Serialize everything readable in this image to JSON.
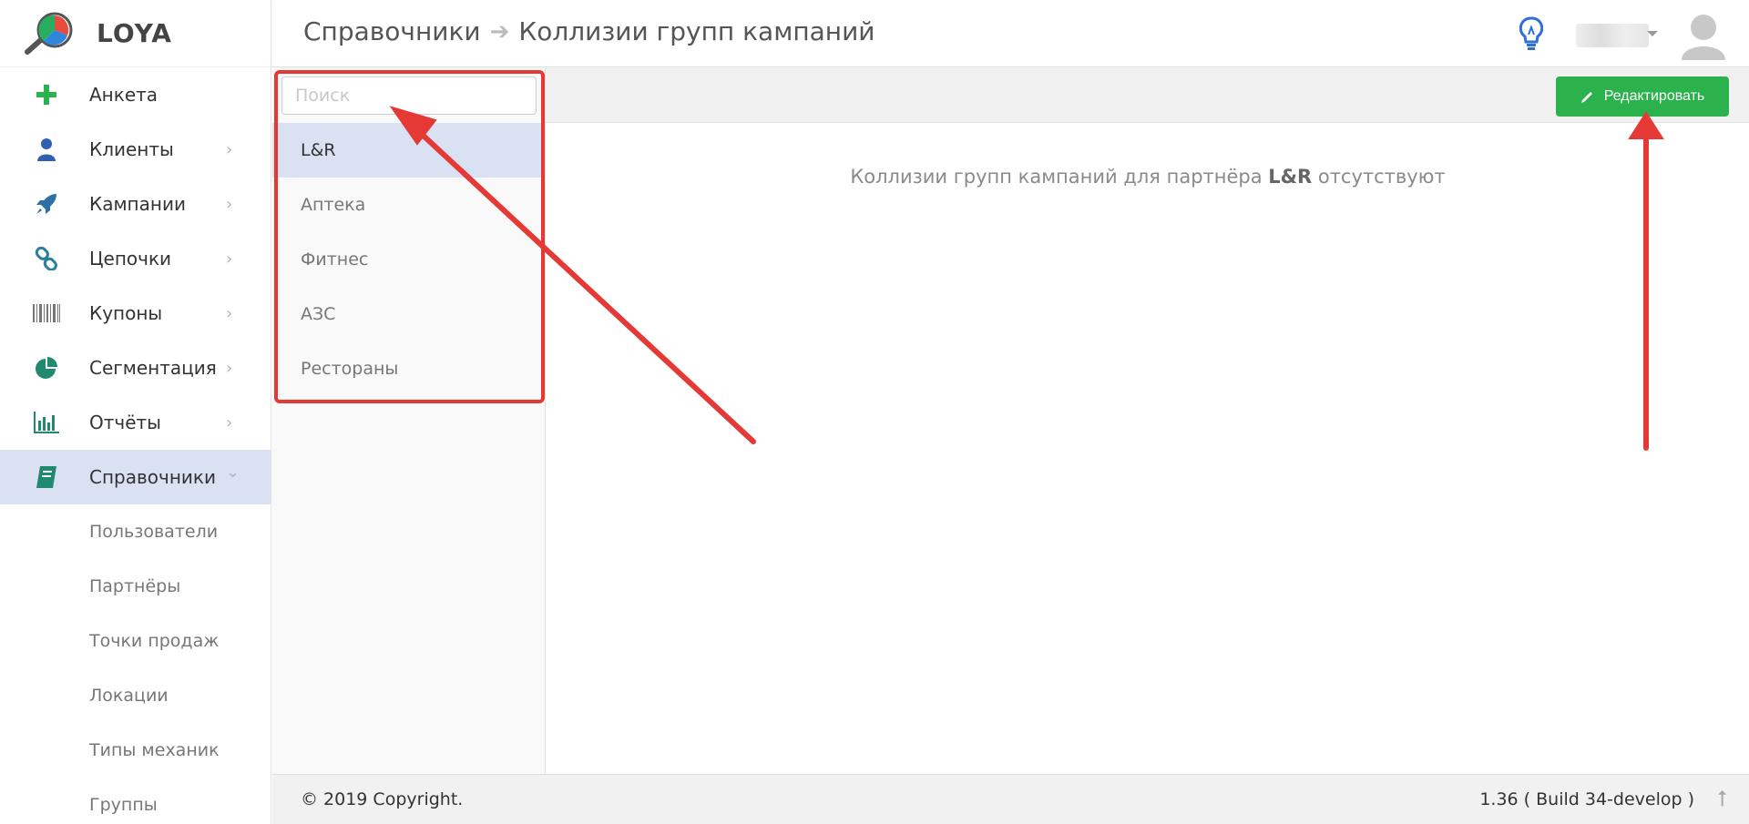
{
  "brand": {
    "name": "LOYA"
  },
  "sidebar": {
    "items": [
      {
        "label": "Анкета",
        "icon": "plus-icon",
        "chevron": ""
      },
      {
        "label": "Клиенты",
        "icon": "user-icon",
        "chevron": "›"
      },
      {
        "label": "Кампании",
        "icon": "rocket-icon",
        "chevron": "›"
      },
      {
        "label": "Цепочки",
        "icon": "chain-icon",
        "chevron": "›"
      },
      {
        "label": "Купоны",
        "icon": "barcode-icon",
        "chevron": "›"
      },
      {
        "label": "Сегментация",
        "icon": "pie-chart-icon",
        "chevron": "›"
      },
      {
        "label": "Отчёты",
        "icon": "bar-chart-icon",
        "chevron": "›"
      },
      {
        "label": "Справочники",
        "icon": "book-icon",
        "chevron": "⌄"
      }
    ],
    "subitems": [
      "Пользователи",
      "Партнёры",
      "Точки продаж",
      "Локации",
      "Типы механик",
      "Группы"
    ]
  },
  "header": {
    "breadcrumb_root": "Справочники",
    "breadcrumb_arrow": "➔",
    "breadcrumb_current": "Коллизии групп кампаний"
  },
  "toolbar": {
    "edit_label": "Редактировать"
  },
  "list": {
    "search_placeholder": "Поиск",
    "items": [
      "L&R",
      "Аптека",
      "Фитнес",
      "АЗС",
      "Рестораны"
    ],
    "selected_index": 0
  },
  "content": {
    "message_prefix": "Коллизии групп кампаний для партнёра ",
    "message_partner": "L&R",
    "message_suffix": " отсутствуют"
  },
  "footer": {
    "copyright": "© 2019 Copyright.",
    "version": "1.36 ( Build 34-develop )",
    "up_arrow": "⭡"
  },
  "colors": {
    "accent_green": "#2bb24c",
    "active_bg": "#d9e1f2",
    "annotation_red": "#e53935"
  }
}
